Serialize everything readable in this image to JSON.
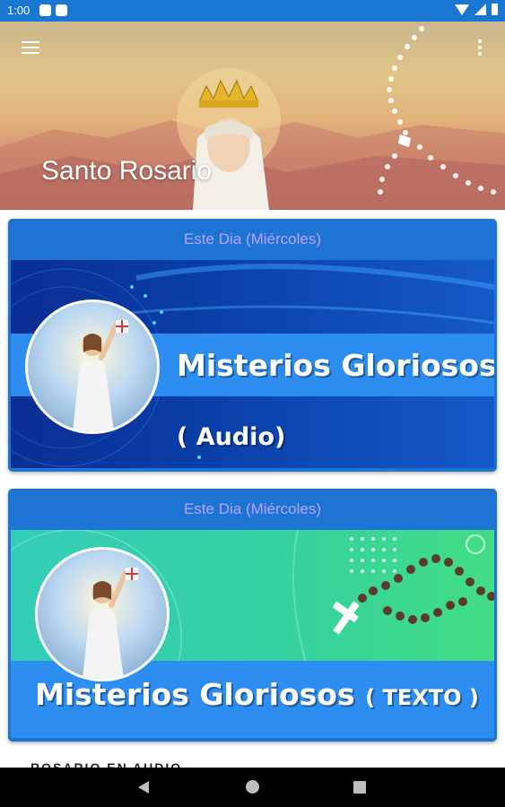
{
  "status_bar": {
    "time": "1:00"
  },
  "header": {
    "title": "Santo Rosario"
  },
  "cards": [
    {
      "day_label": "Este Dia (Miércoles)",
      "banner_title": "Misterios Gloriosos",
      "banner_subtitle": "( Audio)"
    },
    {
      "day_label": "Este Dia (Miércoles)",
      "banner_title": "Misterios Gloriosos",
      "banner_subtitle": "( TEXTO )"
    }
  ],
  "section": {
    "label": "ROSARIO EN AUDIO"
  },
  "colors": {
    "primary": "#1976d2",
    "card_bg": "#1e74d2",
    "day_label": "#bba3ff",
    "banner_strip": "#2d8df0"
  },
  "icons": [
    "menu-icon",
    "more-vert-icon",
    "wifi-icon",
    "signal-icon",
    "battery-icon",
    "back-icon",
    "home-icon",
    "recents-icon"
  ]
}
